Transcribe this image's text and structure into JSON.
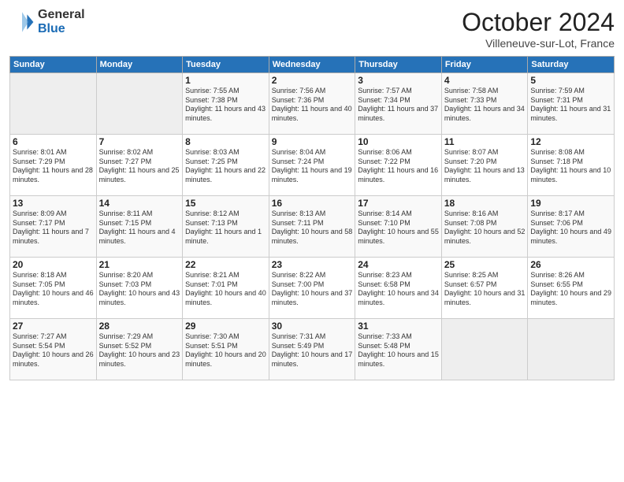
{
  "header": {
    "logo_general": "General",
    "logo_blue": "Blue",
    "title": "October 2024",
    "location": "Villeneuve-sur-Lot, France"
  },
  "weekdays": [
    "Sunday",
    "Monday",
    "Tuesday",
    "Wednesday",
    "Thursday",
    "Friday",
    "Saturday"
  ],
  "weeks": [
    [
      {
        "day": "",
        "info": ""
      },
      {
        "day": "",
        "info": ""
      },
      {
        "day": "1",
        "info": "Sunrise: 7:55 AM\nSunset: 7:38 PM\nDaylight: 11 hours and 43 minutes."
      },
      {
        "day": "2",
        "info": "Sunrise: 7:56 AM\nSunset: 7:36 PM\nDaylight: 11 hours and 40 minutes."
      },
      {
        "day": "3",
        "info": "Sunrise: 7:57 AM\nSunset: 7:34 PM\nDaylight: 11 hours and 37 minutes."
      },
      {
        "day": "4",
        "info": "Sunrise: 7:58 AM\nSunset: 7:33 PM\nDaylight: 11 hours and 34 minutes."
      },
      {
        "day": "5",
        "info": "Sunrise: 7:59 AM\nSunset: 7:31 PM\nDaylight: 11 hours and 31 minutes."
      }
    ],
    [
      {
        "day": "6",
        "info": "Sunrise: 8:01 AM\nSunset: 7:29 PM\nDaylight: 11 hours and 28 minutes."
      },
      {
        "day": "7",
        "info": "Sunrise: 8:02 AM\nSunset: 7:27 PM\nDaylight: 11 hours and 25 minutes."
      },
      {
        "day": "8",
        "info": "Sunrise: 8:03 AM\nSunset: 7:25 PM\nDaylight: 11 hours and 22 minutes."
      },
      {
        "day": "9",
        "info": "Sunrise: 8:04 AM\nSunset: 7:24 PM\nDaylight: 11 hours and 19 minutes."
      },
      {
        "day": "10",
        "info": "Sunrise: 8:06 AM\nSunset: 7:22 PM\nDaylight: 11 hours and 16 minutes."
      },
      {
        "day": "11",
        "info": "Sunrise: 8:07 AM\nSunset: 7:20 PM\nDaylight: 11 hours and 13 minutes."
      },
      {
        "day": "12",
        "info": "Sunrise: 8:08 AM\nSunset: 7:18 PM\nDaylight: 11 hours and 10 minutes."
      }
    ],
    [
      {
        "day": "13",
        "info": "Sunrise: 8:09 AM\nSunset: 7:17 PM\nDaylight: 11 hours and 7 minutes."
      },
      {
        "day": "14",
        "info": "Sunrise: 8:11 AM\nSunset: 7:15 PM\nDaylight: 11 hours and 4 minutes."
      },
      {
        "day": "15",
        "info": "Sunrise: 8:12 AM\nSunset: 7:13 PM\nDaylight: 11 hours and 1 minute."
      },
      {
        "day": "16",
        "info": "Sunrise: 8:13 AM\nSunset: 7:11 PM\nDaylight: 10 hours and 58 minutes."
      },
      {
        "day": "17",
        "info": "Sunrise: 8:14 AM\nSunset: 7:10 PM\nDaylight: 10 hours and 55 minutes."
      },
      {
        "day": "18",
        "info": "Sunrise: 8:16 AM\nSunset: 7:08 PM\nDaylight: 10 hours and 52 minutes."
      },
      {
        "day": "19",
        "info": "Sunrise: 8:17 AM\nSunset: 7:06 PM\nDaylight: 10 hours and 49 minutes."
      }
    ],
    [
      {
        "day": "20",
        "info": "Sunrise: 8:18 AM\nSunset: 7:05 PM\nDaylight: 10 hours and 46 minutes."
      },
      {
        "day": "21",
        "info": "Sunrise: 8:20 AM\nSunset: 7:03 PM\nDaylight: 10 hours and 43 minutes."
      },
      {
        "day": "22",
        "info": "Sunrise: 8:21 AM\nSunset: 7:01 PM\nDaylight: 10 hours and 40 minutes."
      },
      {
        "day": "23",
        "info": "Sunrise: 8:22 AM\nSunset: 7:00 PM\nDaylight: 10 hours and 37 minutes."
      },
      {
        "day": "24",
        "info": "Sunrise: 8:23 AM\nSunset: 6:58 PM\nDaylight: 10 hours and 34 minutes."
      },
      {
        "day": "25",
        "info": "Sunrise: 8:25 AM\nSunset: 6:57 PM\nDaylight: 10 hours and 31 minutes."
      },
      {
        "day": "26",
        "info": "Sunrise: 8:26 AM\nSunset: 6:55 PM\nDaylight: 10 hours and 29 minutes."
      }
    ],
    [
      {
        "day": "27",
        "info": "Sunrise: 7:27 AM\nSunset: 5:54 PM\nDaylight: 10 hours and 26 minutes."
      },
      {
        "day": "28",
        "info": "Sunrise: 7:29 AM\nSunset: 5:52 PM\nDaylight: 10 hours and 23 minutes."
      },
      {
        "day": "29",
        "info": "Sunrise: 7:30 AM\nSunset: 5:51 PM\nDaylight: 10 hours and 20 minutes."
      },
      {
        "day": "30",
        "info": "Sunrise: 7:31 AM\nSunset: 5:49 PM\nDaylight: 10 hours and 17 minutes."
      },
      {
        "day": "31",
        "info": "Sunrise: 7:33 AM\nSunset: 5:48 PM\nDaylight: 10 hours and 15 minutes."
      },
      {
        "day": "",
        "info": ""
      },
      {
        "day": "",
        "info": ""
      }
    ]
  ]
}
